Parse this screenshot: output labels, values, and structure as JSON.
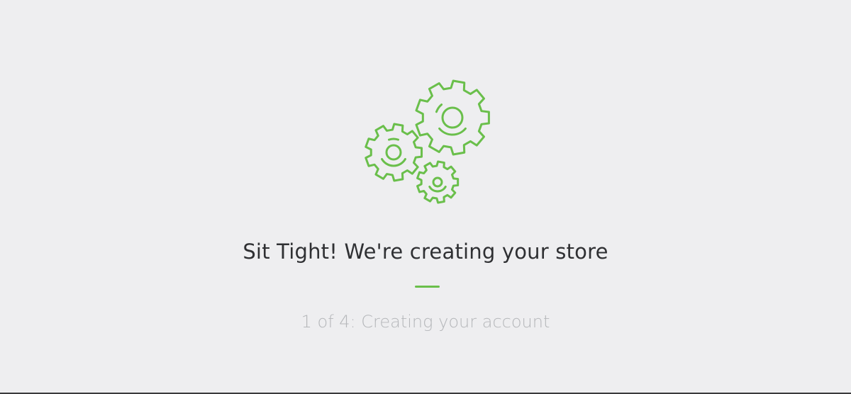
{
  "heading": "Sit Tight! We're creating your store",
  "progress_text": "1 of 4: Creating your account",
  "colors": {
    "background": "#eeeef0",
    "accent": "#6abf4b",
    "heading": "#2f3033",
    "progress": "#b5b7ba"
  },
  "icons": {
    "illustration": "gears-icon"
  }
}
